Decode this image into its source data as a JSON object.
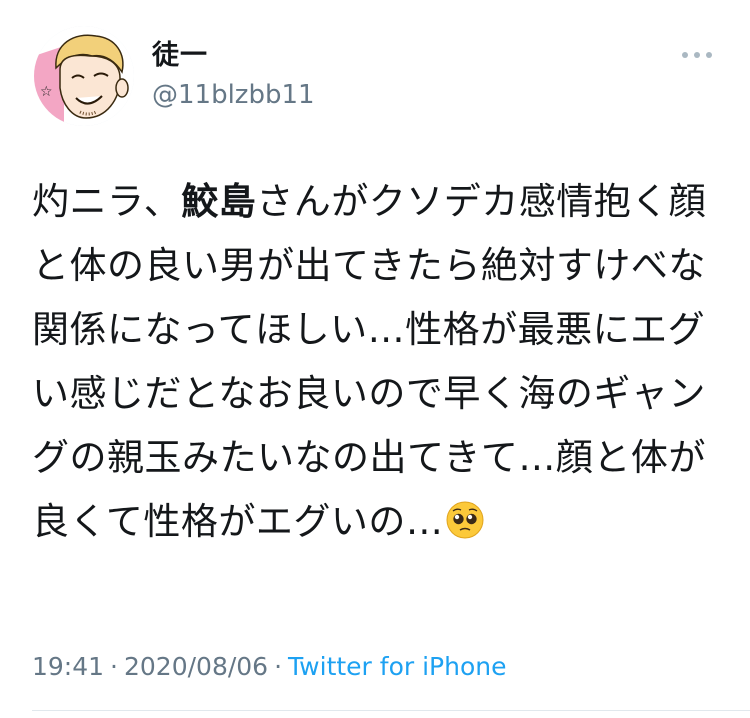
{
  "author": {
    "display_name": "徒一",
    "handle": "@11blzbb11",
    "avatar_icon": "avatar-illustration-icon"
  },
  "more_icon": "more-options-icon",
  "tweet": {
    "text_before_bold": "灼ニラ、",
    "bold_text": "鮫島",
    "text_after_bold": "さんがクソデカ感情抱く顔と体の良い男が出てきたら絶対すけべな関係になってほしい…性格が最悪にエグい感じだとなお良いので早く海のギャングの親玉みたいなの出てきて…顔と体が良くて性格がエグいの…",
    "emoji": "pleading-face-emoji"
  },
  "meta": {
    "time": "19:41",
    "separator": "·",
    "date": "2020/08/06",
    "source": "Twitter for iPhone"
  },
  "colors": {
    "text": "#14171a",
    "secondary": "#657786",
    "link": "#1da1f2",
    "divider": "#e1e8ed"
  }
}
